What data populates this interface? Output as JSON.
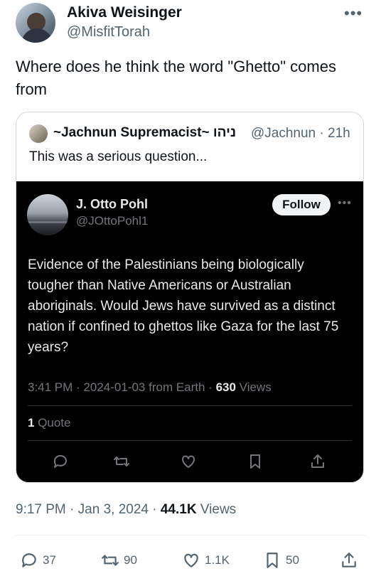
{
  "author": {
    "name": "Akiva Weisinger",
    "handle": "@MisfitTorah"
  },
  "tweet": {
    "text": "Where does he think the word \"Ghetto\" comes from",
    "time": "9:17 PM",
    "date": "Jan 3, 2024",
    "views_count": "44.1K",
    "views_label": "Views"
  },
  "quote": {
    "name": "~Jachnun Supremacist~ ניהו",
    "handle": "@Jachnun · 21h",
    "text": "This was a serious question...",
    "embedded": {
      "name": "J. Otto Pohl",
      "handle": "@JOttoPohl1",
      "follow_label": "Follow",
      "text": "Evidence of the Palestinians being biologically tougher than Native Americans or Australian aboriginals. Would Jews have survived as a distinct nation if confined to ghettos like Gaza for the last 75  years?",
      "meta": "3:41 PM · 2024-01-03 from Earth · ",
      "views_count": "630",
      "views_label": " Views",
      "quote_count": "1",
      "quote_label": " Quote"
    }
  },
  "actions": {
    "replies": "37",
    "reposts": "90",
    "likes": "1.1K",
    "bookmarks": "50"
  },
  "icons": [
    "more-icon",
    "reply-icon",
    "repost-icon",
    "like-icon",
    "bookmark-icon",
    "share-icon"
  ]
}
